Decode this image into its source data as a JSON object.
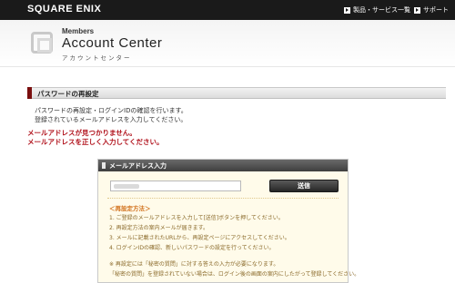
{
  "topbar": {
    "logo": "SQUARE ENIX",
    "products_link": "製品・サービス一覧",
    "support_link": "サポート"
  },
  "header": {
    "members": "Members",
    "title": "Account Center",
    "katakana": "アカウントセンター"
  },
  "section": {
    "title": "パスワードの再設定"
  },
  "description": {
    "line1": "パスワードの再設定・ログインIDの確認を行います。",
    "line2": "登録されているメールアドレスを入力してください。"
  },
  "errors": {
    "line1": "メールアドレスが見つかりません。",
    "line2": "メールアドレスを正しく入力してください。"
  },
  "panel": {
    "title": "メールアドレス入力",
    "email_value": "",
    "submit_label": "送信",
    "howto_title": "＜再設定方法＞",
    "steps": [
      "1. ご登録のメールアドレスを入力して[送信]ボタンを押してください。",
      "2. 再設定方法の案内メールが届きます。",
      "3. メールに記載されたURLから、再設定ページにアクセスしてください。",
      "4. ログインIDの確認、新しいパスワードの設定を行ってください。"
    ],
    "note1": "※ 再設定には「秘密の質問」に対する答えの入力が必要になります。",
    "note2": "「秘密の質問」を登録されていない場合は、ログイン後の画面の案内にしたがって登録してください。"
  }
}
